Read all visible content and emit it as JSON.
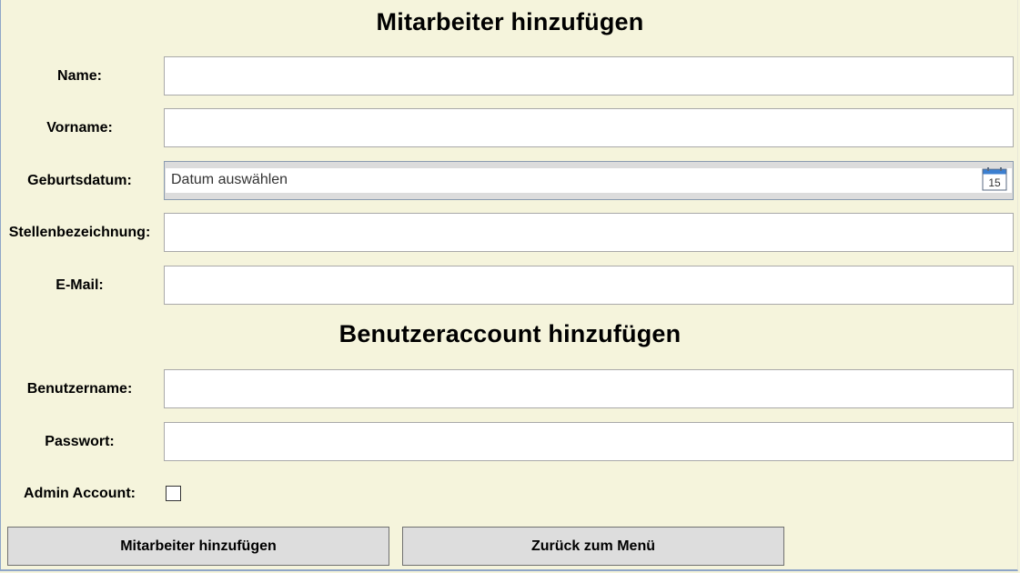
{
  "employee_section": {
    "title": "Mitarbeiter hinzufügen",
    "name_label": "Name:",
    "name_value": "",
    "firstname_label": "Vorname:",
    "firstname_value": "",
    "birthdate_label": "Geburtsdatum:",
    "birthdate_placeholder": "Datum auswählen",
    "calendar_icon_day": "15",
    "jobtitle_label": "Stellenbezeichnung:",
    "jobtitle_value": "",
    "email_label": "E-Mail:",
    "email_value": ""
  },
  "account_section": {
    "title": "Benutzeraccount hinzufügen",
    "username_label": "Benutzername:",
    "username_value": "",
    "password_label": "Passwort:",
    "password_value": "",
    "admin_label": "Admin Account:",
    "admin_checked": false
  },
  "actions": {
    "add_label": "Mitarbeiter hinzufügen",
    "back_label": "Zurück zum Menü"
  },
  "icons": {
    "calendar": "calendar-icon"
  },
  "colors": {
    "background": "#f5f4dc",
    "button": "#dddddd",
    "calendar_accent": "#3b7fd0"
  }
}
